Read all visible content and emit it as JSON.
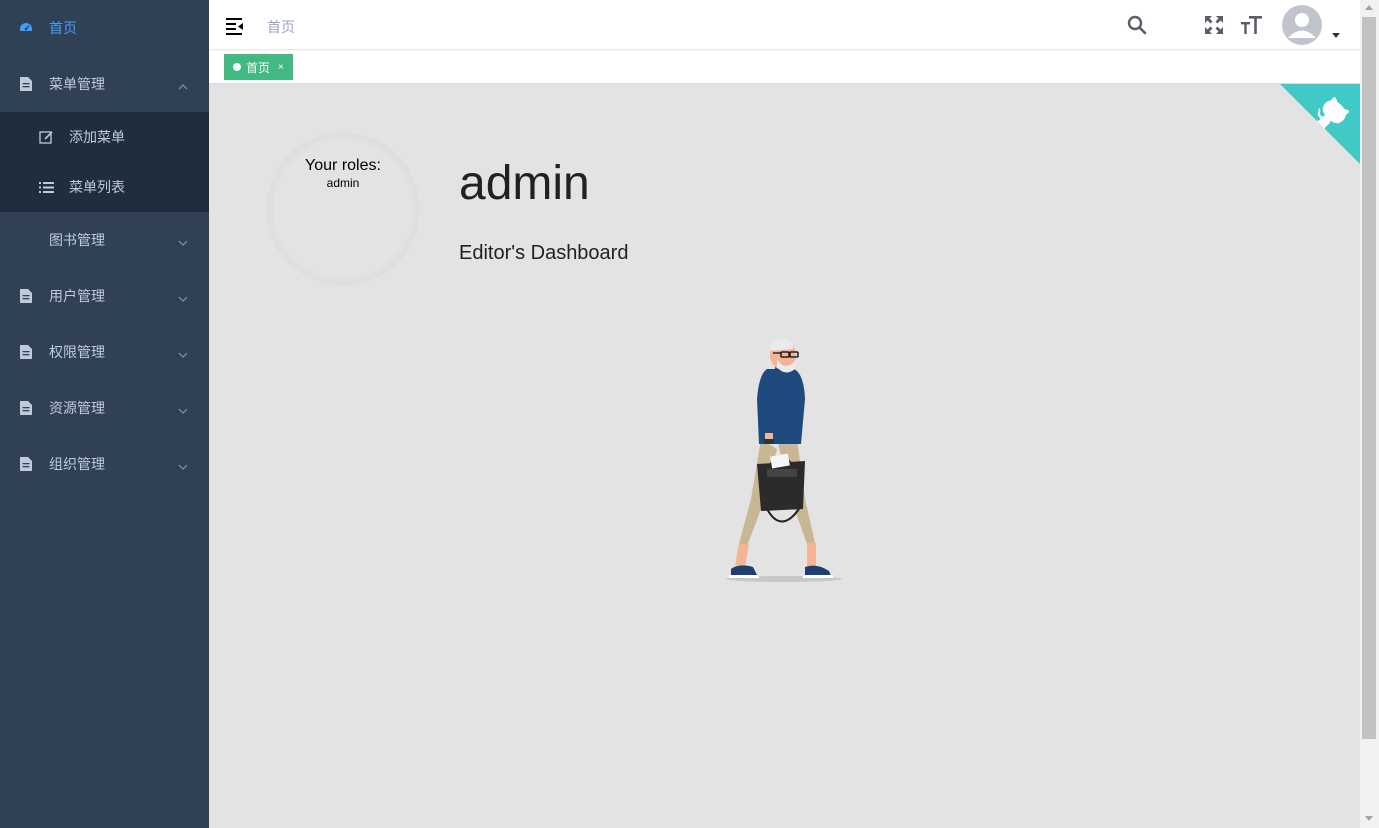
{
  "sidebar": {
    "items": [
      {
        "label": "首页",
        "icon": "dashboard-icon",
        "active": true
      },
      {
        "label": "菜单管理",
        "icon": "document-icon",
        "expanded": true,
        "children": [
          {
            "label": "添加菜单",
            "icon": "edit-icon"
          },
          {
            "label": "菜单列表",
            "icon": "list-icon"
          }
        ]
      },
      {
        "label": "图书管理",
        "icon": null
      },
      {
        "label": "用户管理",
        "icon": "document-icon"
      },
      {
        "label": "权限管理",
        "icon": "document-icon"
      },
      {
        "label": "资源管理",
        "icon": "document-icon"
      },
      {
        "label": "组织管理",
        "icon": "document-icon"
      }
    ]
  },
  "navbar": {
    "breadcrumb": "首页",
    "icons": [
      "hamburger-icon",
      "search-icon",
      "fullscreen-icon",
      "font-size-icon",
      "avatar",
      "caret-down-icon"
    ]
  },
  "tags": [
    {
      "label": "首页",
      "close": "×"
    }
  ],
  "main": {
    "roles_title": "Your roles:",
    "roles_value": "admin",
    "name": "admin",
    "dashboard_title": "Editor's Dashboard"
  },
  "colors": {
    "sidebar_bg": "#304156",
    "submenu_bg": "#1f2d3d",
    "active": "#409eff",
    "menu_text": "#bfcbd9",
    "tag_active": "#42b983",
    "github_corner": "#40c9c6",
    "main_bg": "#e3e3e3"
  }
}
